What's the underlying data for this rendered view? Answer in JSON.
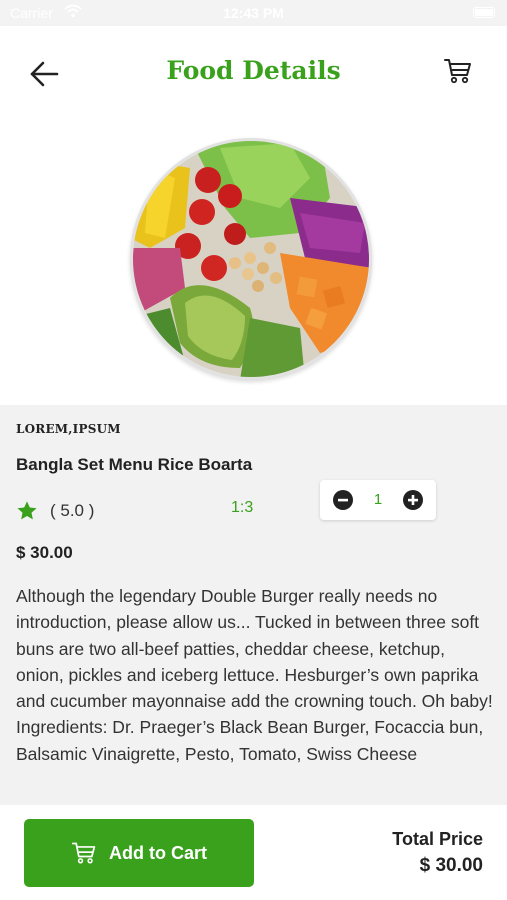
{
  "status_bar": {
    "carrier": "Carrier",
    "time": "12:43 PM"
  },
  "header": {
    "title": "Food Details",
    "back_icon": "arrow-left-icon",
    "cart_icon": "cart-icon"
  },
  "food": {
    "category": "LOREM,IPSUM",
    "name": "Bangla Set Menu Rice Boarta",
    "rating": "( 5.0 )",
    "ratio": "1:3",
    "quantity": "1",
    "price": "$ 30.00",
    "description": "Although the legendary Double Burger really needs no introduction, please allow us... Tucked in between three soft buns are two all-beef patties, cheddar cheese, ketchup, onion, pickles and iceberg lettuce. Hesburger’s own paprika and cucumber mayonnaise add the crowning touch. Oh baby!  Ingredients: Dr. Praeger’s Black Bean Burger, Focaccia bun, Balsamic Vinaigrette, Pesto, Tomato, Swiss Cheese"
  },
  "footer": {
    "add_to_cart_label": "Add to Cart",
    "total_label": "Total Price",
    "total_value": "$ 30.00"
  },
  "colors": {
    "accent": "#3aa11d",
    "background_gray": "#f2f2f2"
  }
}
